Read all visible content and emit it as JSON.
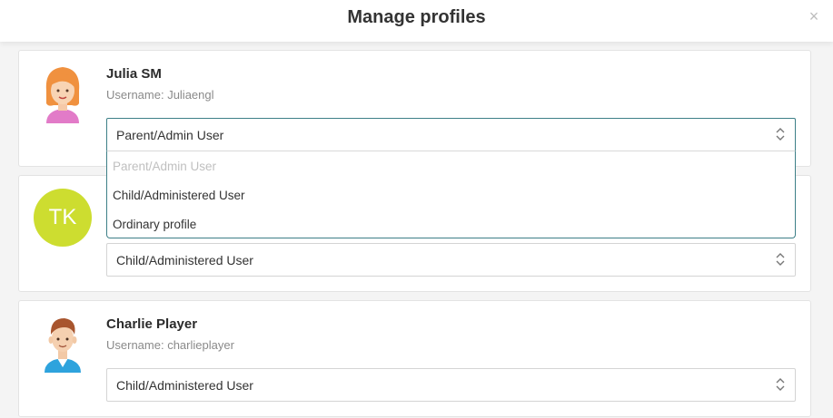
{
  "modal": {
    "title": "Manage profiles",
    "close_label": "×"
  },
  "profiles": [
    {
      "name": "Julia SM",
      "username": "Username: Juliaengl",
      "role": "Parent/Admin User",
      "avatar": "girl-avatar-icon"
    },
    {
      "initials": "TK",
      "initials_color": "#cddd30",
      "role": "Child/Administered User"
    },
    {
      "name": "Charlie Player",
      "username": "Username: charlieplayer",
      "role": "Child/Administered User",
      "avatar": "boy-avatar-icon"
    }
  ],
  "dropdown": {
    "options": [
      {
        "label": "Parent/Admin User",
        "disabled": true
      },
      {
        "label": "Child/Administered User",
        "disabled": false
      },
      {
        "label": "Ordinary profile",
        "disabled": false
      }
    ]
  },
  "colors": {
    "accent_border": "#3d7f87",
    "card_border": "#e3e3e3",
    "page_bg": "#f4f4f4"
  }
}
